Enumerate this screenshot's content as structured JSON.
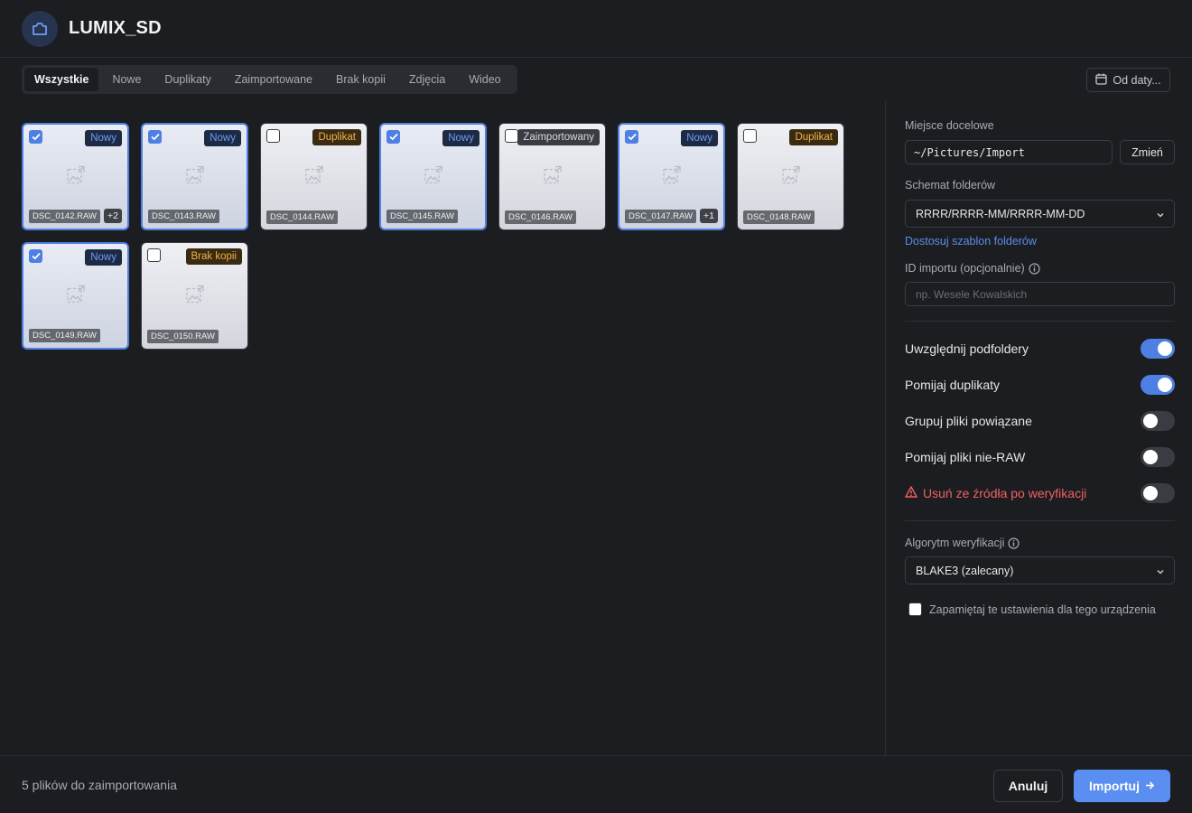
{
  "header": {
    "title": "LUMIX_SD",
    "icon": "camera-icon"
  },
  "tabs": [
    {
      "label": "Wszystkie",
      "active": true
    },
    {
      "label": "Nowe"
    },
    {
      "label": "Duplikaty"
    },
    {
      "label": "Zaimportowane"
    },
    {
      "label": "Brak kopii"
    },
    {
      "label": "Zdjęcia"
    },
    {
      "label": "Wideo"
    }
  ],
  "date_filter": {
    "label": "Od daty..."
  },
  "files": [
    {
      "name": "DSC_0142.RAW",
      "status": "Nowy",
      "kind": "nowy",
      "selected": true,
      "extra": "+2"
    },
    {
      "name": "DSC_0143.RAW",
      "status": "Nowy",
      "kind": "nowy",
      "selected": true,
      "extra": ""
    },
    {
      "name": "DSC_0144.RAW",
      "status": "Duplikat",
      "kind": "duplikat",
      "selected": false,
      "extra": ""
    },
    {
      "name": "DSC_0145.RAW",
      "status": "Nowy",
      "kind": "nowy",
      "selected": true,
      "extra": ""
    },
    {
      "name": "DSC_0146.RAW",
      "status": "Zaimportowany",
      "kind": "zaimportowany",
      "selected": false,
      "extra": ""
    },
    {
      "name": "DSC_0147.RAW",
      "status": "Nowy",
      "kind": "nowy",
      "selected": true,
      "extra": "+1"
    },
    {
      "name": "DSC_0148.RAW",
      "status": "Duplikat",
      "kind": "duplikat",
      "selected": false,
      "extra": ""
    },
    {
      "name": "DSC_0149.RAW",
      "status": "Nowy",
      "kind": "nowy",
      "selected": true,
      "extra": ""
    },
    {
      "name": "DSC_0150.RAW",
      "status": "Brak kopii",
      "kind": "brak",
      "selected": false,
      "extra": ""
    }
  ],
  "panel": {
    "destination_label": "Miejsce docelowe",
    "destination_value": "~/Pictures/Import",
    "change_label": "Zmień",
    "scheme_label": "Schemat folderów",
    "scheme_value": "RRRR/RRRR-MM/RRRR-MM-DD",
    "customize_link": "Dostosuj szablon folderów",
    "import_id_label": "ID importu (opcjonalnie)",
    "import_id_placeholder": "np. Wesele Kowalskich",
    "toggles": [
      {
        "label": "Uwzględnij podfoldery",
        "on": true
      },
      {
        "label": "Pomijaj duplikaty",
        "on": true
      },
      {
        "label": "Grupuj pliki powiązane",
        "on": false
      },
      {
        "label": "Pomijaj pliki nie-RAW",
        "on": false
      },
      {
        "label": "Usuń ze źródła po weryfikacji",
        "on": false,
        "danger": true
      }
    ],
    "algorithm_label": "Algorytm weryfikacji",
    "algorithm_value": "BLAKE3 (zalecany)",
    "remember_label": "Zapamiętaj te ustawienia dla tego urządzenia"
  },
  "footer": {
    "summary": "5 plików do zaimportowania",
    "cancel_label": "Anuluj",
    "import_label": "Importuj"
  },
  "colors": {
    "accent": "#4e7fe2",
    "danger": "#f06060",
    "background": "#1c1d21"
  }
}
